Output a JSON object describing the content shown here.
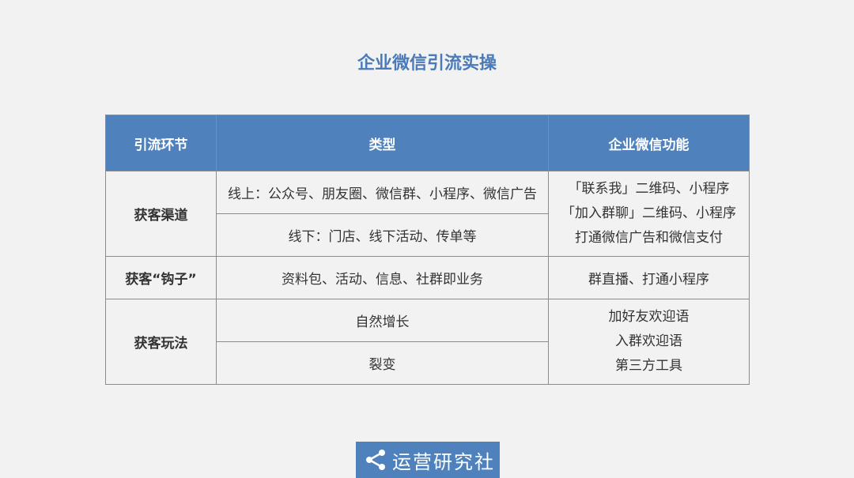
{
  "title": "企业微信引流实操",
  "table": {
    "headers": [
      "引流环节",
      "类型",
      "企业微信功能"
    ],
    "groups": [
      {
        "label": "获客渠道",
        "types": [
          "线上：公众号、朋友圈、微信群、小程序、微信广告",
          "线下：门店、线下活动、传单等"
        ],
        "features": [
          "「联系我」二维码、小程序",
          "「加入群聊」二维码、小程序",
          "打通微信广告和微信支付"
        ]
      },
      {
        "label": "获客“钩子”",
        "types": [
          "资料包、活动、信息、社群即业务"
        ],
        "features": [
          "群直播、打通小程序"
        ]
      },
      {
        "label": "获客玩法",
        "types": [
          "自然增长",
          "裂变"
        ],
        "features": [
          "加好友欢迎语",
          "入群欢迎语",
          "第三方工具"
        ]
      }
    ]
  },
  "logo": {
    "icon": "share-icon",
    "text": "运营研究社"
  }
}
